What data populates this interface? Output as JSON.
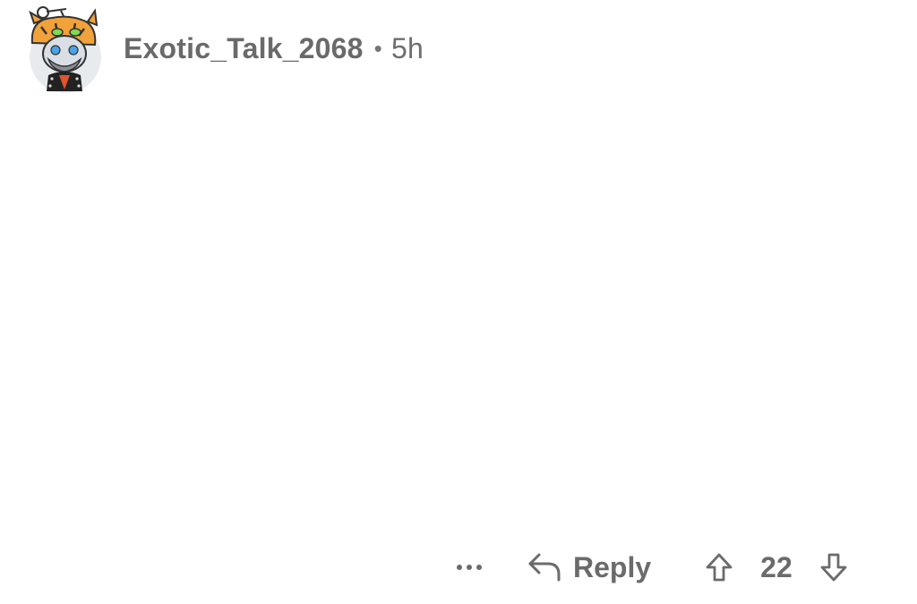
{
  "comment": {
    "username": "Exotic_Talk_2068",
    "separator": "•",
    "timestamp": "5h",
    "avatar_icon": "tiger-hat-avatar-icon",
    "body_text": ""
  },
  "actions": {
    "more_icon": "more-options-icon",
    "reply_icon": "reply-arrow-icon",
    "reply_label": "Reply",
    "upvote_icon": "upvote-arrow-icon",
    "score": "22",
    "downvote_icon": "downvote-arrow-icon"
  },
  "colors": {
    "text_muted": "#6b6b6b",
    "background": "#ffffff",
    "avatar_bg": "#e9ecef",
    "tiger_orange": "#f2a23a"
  }
}
